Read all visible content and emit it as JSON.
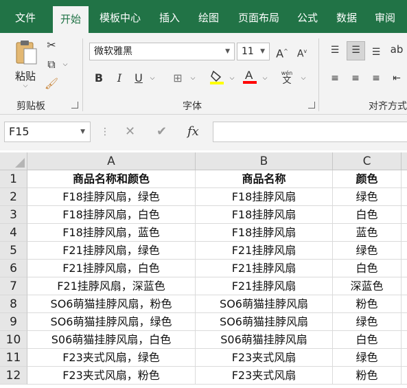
{
  "ribbon_tabs": [
    "文件",
    "开始",
    "模板中心",
    "插入",
    "绘图",
    "页面布局",
    "公式",
    "数据",
    "审阅"
  ],
  "active_tab": "开始",
  "clipboard": {
    "paste_label": "粘贴",
    "group_label": "剪贴板"
  },
  "font": {
    "name": "微软雅黑",
    "size": "11",
    "group_label": "字体",
    "phonetic_label": "wén",
    "font_color": "#ff0000",
    "fill_color": "#ffff00"
  },
  "alignment": {
    "group_label": "对齐方式"
  },
  "formula_bar": {
    "name_box": "F15",
    "fx_label": "fx",
    "formula": ""
  },
  "columns": [
    "A",
    "B",
    "C"
  ],
  "rows": [
    {
      "num": "1",
      "cells": [
        "商品名称和颜色",
        "商品名称",
        "颜色"
      ]
    },
    {
      "num": "2",
      "cells": [
        "F18挂脖风扇，绿色",
        "F18挂脖风扇",
        "绿色"
      ]
    },
    {
      "num": "3",
      "cells": [
        "F18挂脖风扇，白色",
        "F18挂脖风扇",
        "白色"
      ]
    },
    {
      "num": "4",
      "cells": [
        "F18挂脖风扇，蓝色",
        "F18挂脖风扇",
        "蓝色"
      ]
    },
    {
      "num": "5",
      "cells": [
        "F21挂脖风扇，绿色",
        "F21挂脖风扇",
        "绿色"
      ]
    },
    {
      "num": "6",
      "cells": [
        "F21挂脖风扇，白色",
        "F21挂脖风扇",
        "白色"
      ]
    },
    {
      "num": "7",
      "cells": [
        "F21挂脖风扇，深蓝色",
        "F21挂脖风扇",
        "深蓝色"
      ]
    },
    {
      "num": "8",
      "cells": [
        "SO6萌猫挂脖风扇，粉色",
        "SO6萌猫挂脖风扇",
        "粉色"
      ]
    },
    {
      "num": "9",
      "cells": [
        "SO6萌猫挂脖风扇，绿色",
        "SO6萌猫挂脖风扇",
        "绿色"
      ]
    },
    {
      "num": "10",
      "cells": [
        "S06萌猫挂脖风扇，白色",
        "S06萌猫挂脖风扇",
        "白色"
      ]
    },
    {
      "num": "11",
      "cells": [
        "F23夹式风扇，绿色",
        "F23夹式风扇",
        "绿色"
      ]
    },
    {
      "num": "12",
      "cells": [
        "F23夹式风扇，粉色",
        "F23夹式风扇",
        "粉色"
      ]
    }
  ]
}
